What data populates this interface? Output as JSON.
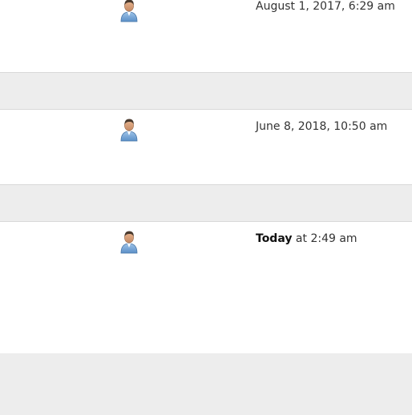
{
  "entries": [
    {
      "avatar_icon": "user-avatar-icon",
      "timestamp": "August 1, 2017, 6:29 am"
    },
    {
      "avatar_icon": "user-avatar-icon",
      "timestamp": "June 8, 2018, 10:50 am"
    },
    {
      "avatar_icon": "user-avatar-icon",
      "timestamp_day": "Today",
      "timestamp_time": " at 2:49 am"
    }
  ],
  "colors": {
    "page_background": "#ededed",
    "row_background": "#ffffff",
    "separator_border": "#d8d8d8",
    "text": "#333333"
  }
}
